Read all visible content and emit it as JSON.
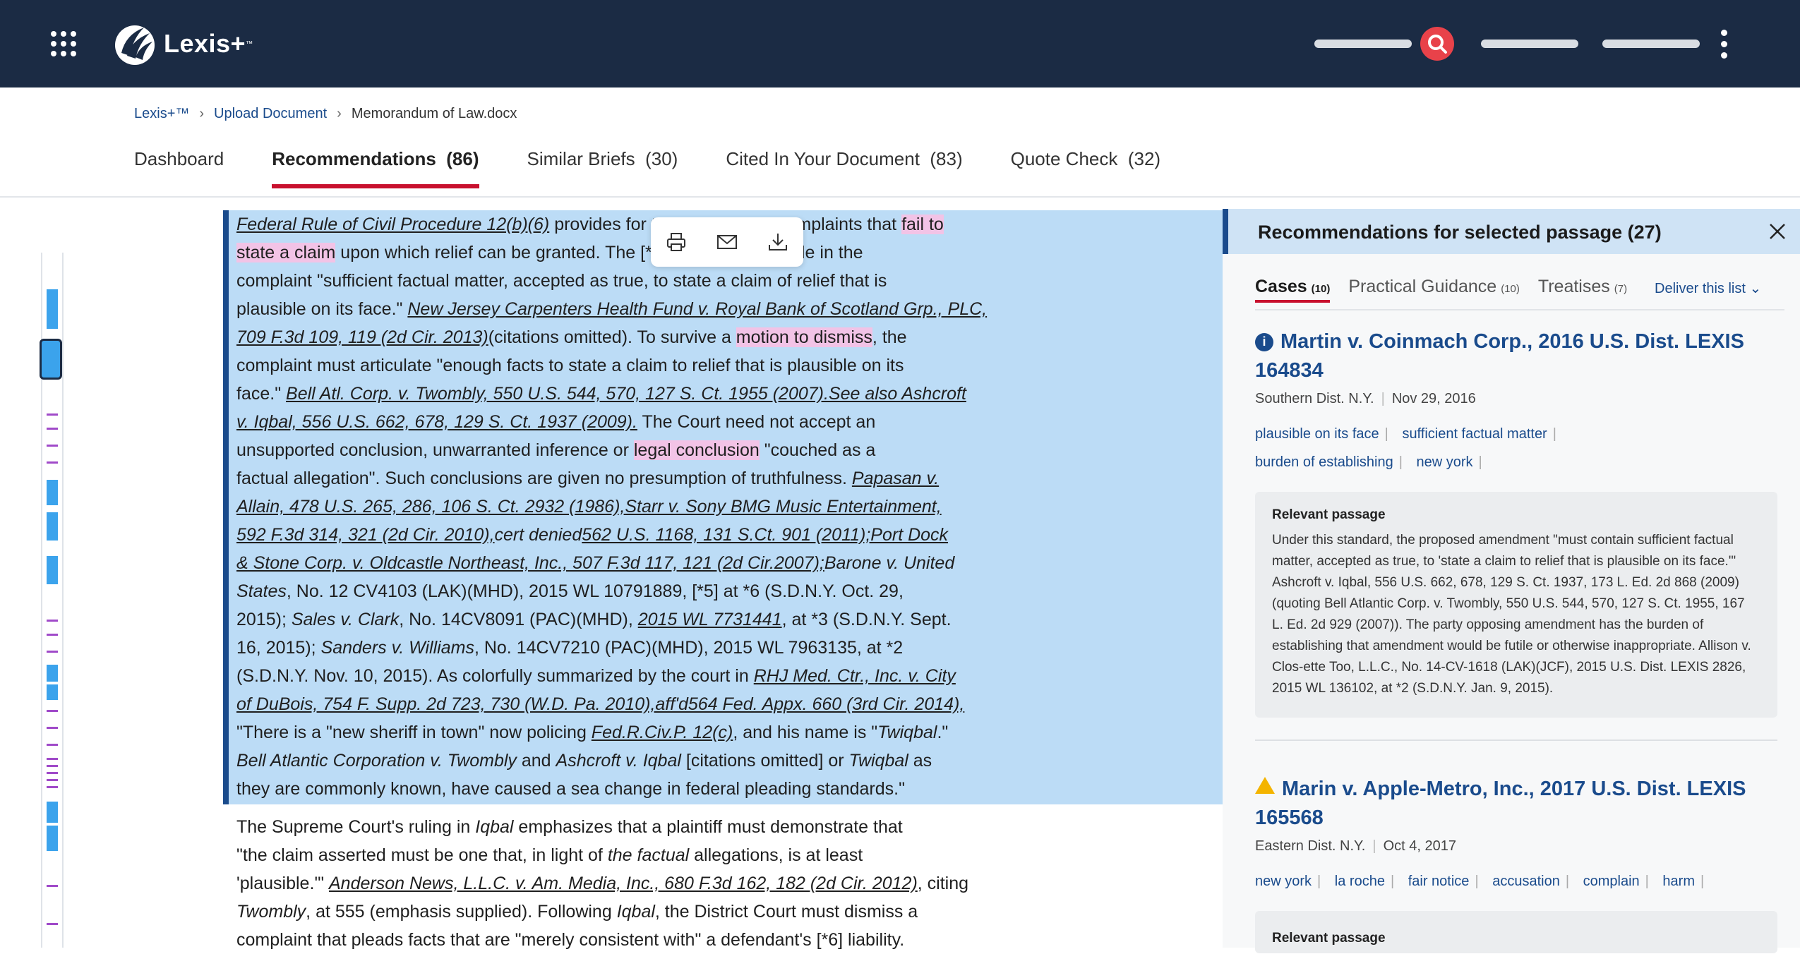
{
  "header": {
    "brand": "Lexis+",
    "brand_tm": "™",
    "colors": {
      "bar": "#1b2b44",
      "accent": "#e8424a"
    }
  },
  "breadcrumb": [
    "Lexis+™",
    "Upload Document",
    "Memorandum of Law.docx"
  ],
  "tabs": [
    {
      "label": "Dashboard"
    },
    {
      "label": "Recommendations  (86)",
      "active": true
    },
    {
      "label": "Similar Briefs  (30)"
    },
    {
      "label": "Cited In Your Document  (83)"
    },
    {
      "label": "Quote Check  (32)"
    }
  ],
  "selection_toolbar": {
    "icons": [
      "print-icon",
      "email-icon",
      "download-icon"
    ]
  },
  "document": {
    "lines": [
      [
        [
          "u",
          "Federal Rule of Civil Procedure 12(b)(6)"
        ],
        [
          "t",
          " provides for the dismissal of complaints that "
        ],
        [
          "p",
          "fail to"
        ]
      ],
      [
        [
          "p",
          "state a claim"
        ],
        [
          "t",
          " upon which relief can be granted. The [*4] court must include in the"
        ]
      ],
      [
        [
          "t",
          "complaint \"sufficient factual matter, accepted as true, to state a claim of relief that is"
        ]
      ],
      [
        [
          "t",
          "plausible on its face.\" "
        ],
        [
          "u",
          "New Jersey Carpenters Health Fund v. Royal Bank of Scotland Grp., PLC,"
        ]
      ],
      [
        [
          "u",
          "709 F.3d 109, 119 (2d Cir. 2013)"
        ],
        [
          "t",
          "(citations omitted). To survive a "
        ],
        [
          "p",
          "motion to dismiss"
        ],
        [
          "t",
          ", the"
        ]
      ],
      [
        [
          "t",
          "complaint must articulate \"enough facts to state a claim to relief that is plausible on its"
        ]
      ],
      [
        [
          "t",
          "face.\" "
        ],
        [
          "u",
          "Bell Atl. Corp. v. Twombly, 550 U.S. 544, 570, 127 S. Ct. 1955 (2007).See also Ashcroft"
        ]
      ],
      [
        [
          "u",
          "v. Iqbal, 556 U.S. 662, 678, 129 S. Ct. 1937 (2009)."
        ],
        [
          "t",
          " The Court need not accept an"
        ]
      ],
      [
        [
          "t",
          "unsupported conclusion, unwarranted inference or "
        ],
        [
          "p",
          "legal conclusion"
        ],
        [
          "t",
          " \"couched as a"
        ]
      ],
      [
        [
          "t",
          "factual allegation\". Such conclusions are given no presumption of truthfulness. "
        ],
        [
          "u",
          "Papasan v."
        ]
      ],
      [
        [
          "u",
          "Allain, 478 U.S. 265, 286, 106 S. Ct. 2932 (1986),Starr v. Sony BMG Music Entertainment,"
        ]
      ],
      [
        [
          "u",
          "592 F.3d 314, 321 (2d Cir. 2010),"
        ],
        [
          "i",
          "cert denied"
        ],
        [
          "u",
          "562 U.S. 1168, 131 S.Ct. 901 (2011);Port Dock"
        ]
      ],
      [
        [
          "u",
          "& Stone Corp. v. Oldcastle Northeast, Inc., 507 F.3d 117, 121 (2d Cir.2007);"
        ],
        [
          "i",
          "Barone v. United"
        ]
      ],
      [
        [
          "i",
          "States"
        ],
        [
          "t",
          ", No. 12 CV4103 (LAK)(MHD), 2015 WL 10791889, [*5] at *6 (S.D.N.Y. Oct. 29,"
        ]
      ],
      [
        [
          "t",
          "2015); "
        ],
        [
          "i",
          "Sales v. Clark"
        ],
        [
          "t",
          ", No. 14CV8091 (PAC)(MHD), "
        ],
        [
          "u",
          "2015 WL 7731441"
        ],
        [
          "t",
          ", at *3 (S.D.N.Y. Sept."
        ]
      ],
      [
        [
          "t",
          "16, 2015); "
        ],
        [
          "i",
          "Sanders v. Williams"
        ],
        [
          "t",
          ", No. 14CV7210 (PAC)(MHD), 2015 WL 7963135, at *2"
        ]
      ],
      [
        [
          "t",
          "(S.D.N.Y. Nov. 10, 2015). As colorfully summarized by the court in "
        ],
        [
          "u",
          "RHJ Med. Ctr., Inc. v. City"
        ]
      ],
      [
        [
          "u",
          "of DuBois, 754 F. Supp. 2d 723, 730 (W.D. Pa. 2010),aff'd564 Fed. Appx. 660 (3rd Cir. 2014),"
        ]
      ],
      [
        [
          "t",
          "\"There is a \"new sheriff in town\" now policing "
        ],
        [
          "u",
          "Fed.R.Civ.P. 12(c)"
        ],
        [
          "t",
          ", and his name is \""
        ],
        [
          "i",
          "Twiqbal"
        ],
        [
          "t",
          ".\""
        ]
      ],
      [
        [
          "i",
          "Bell Atlantic Corporation v. Twombly"
        ],
        [
          "t",
          " and "
        ],
        [
          "i",
          "Ashcroft v. Iqbal"
        ],
        [
          "t",
          " [citations omitted] or "
        ],
        [
          "i",
          "Twiqbal"
        ],
        [
          "t",
          " as"
        ]
      ],
      [
        [
          "t",
          "they are commonly known, have caused a sea change in federal pleading standards.\""
        ]
      ],
      [
        [
          "t",
          "The Supreme Court's ruling in "
        ],
        [
          "i",
          "Iqbal"
        ],
        [
          "t",
          " emphasizes that a plaintiff must demonstrate that"
        ]
      ],
      [
        [
          "t",
          "\"the claim asserted must be one that, in light of "
        ],
        [
          "i",
          "the factual"
        ],
        [
          "t",
          " allegations, is at least"
        ]
      ],
      [
        [
          "t",
          "'plausible.'\" "
        ],
        [
          "u",
          "Anderson News, L.L.C. v. Am. Media, Inc., 680 F.3d 162, 182 (2d Cir. 2012)"
        ],
        [
          "t",
          ", citing"
        ]
      ],
      [
        [
          "i",
          "Twombly"
        ],
        [
          "t",
          ", at 555 (emphasis supplied). Following "
        ],
        [
          "i",
          "Iqbal"
        ],
        [
          "t",
          ", the District Court must dismiss a"
        ]
      ],
      [
        [
          "t",
          "complaint that pleads facts that are \"merely consistent with\" a defendant's [*6] liability."
        ]
      ]
    ]
  },
  "panel": {
    "title": "Recommendations for selected passage (27)",
    "tabs": [
      {
        "label": "Cases",
        "count": "(10)",
        "active": true
      },
      {
        "label": "Practical Guidance",
        "count": "(10)"
      },
      {
        "label": "Treatises",
        "count": "(7)"
      }
    ],
    "deliver": "Deliver this list",
    "cases": [
      {
        "title": "Martin v. Coinmach Corp., 2016 U.S. Dist. LEXIS 164834",
        "court": "Southern Dist. N.Y.",
        "date": "Nov 29, 2016",
        "tags": [
          "plausible on its face",
          "sufficient factual matter",
          "burden of establishing",
          "new york"
        ],
        "passage_label": "Relevant passage",
        "passage": "Under this standard, the proposed amendment \"must contain sufficient factual matter, accepted as true, to 'state a claim to relief that is plausible on its face.'\" Ashcroft v. Iqbal, 556 U.S. 662, 678, 129 S. Ct. 1937, 173 L. Ed. 2d 868 (2009) (quoting Bell Atlantic Corp. v. Twombly, 550 U.S. 544, 570, 127 S. Ct. 1955, 167 L. Ed. 2d 929 (2007)). The party opposing amendment has the burden of establishing that amendment would be futile or otherwise inappropriate. Allison v. Clos-ette Too, L.L.C., No. 14-CV-1618 (LAK)(JCF), 2015 U.S. Dist. LEXIS 2826, 2015 WL 136102, at *2 (S.D.N.Y. Jan. 9, 2015)."
      },
      {
        "title": "Marin v. Apple-Metro, Inc., 2017 U.S. Dist. LEXIS 165568",
        "court": "Eastern Dist. N.Y.",
        "date": "Oct 4, 2017",
        "tags": [
          "new york",
          "la roche",
          "fair notice",
          "accusation",
          "complain",
          "harm"
        ],
        "passage_label": "Relevant passage"
      }
    ]
  }
}
